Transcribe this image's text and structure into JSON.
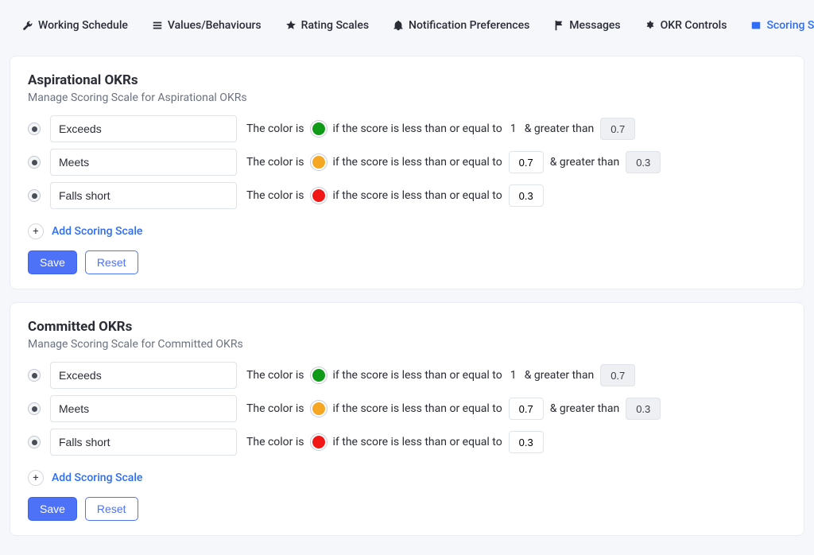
{
  "tabs": [
    {
      "label": "Working Schedule"
    },
    {
      "label": "Values/Behaviours"
    },
    {
      "label": "Rating Scales"
    },
    {
      "label": "Notification Preferences"
    },
    {
      "label": "Messages"
    },
    {
      "label": "OKR Controls"
    },
    {
      "label": "Scoring Scale",
      "active": true
    }
  ],
  "ui": {
    "add_scale": "Add Scoring Scale",
    "save": "Save",
    "reset": "Reset",
    "color_is": "The color is",
    "if_lte": "if the score is less than or equal to",
    "and_gt": "& greater than"
  },
  "colors": {
    "green": "#0f9a17",
    "amber": "#f5a623",
    "red": "#f11717"
  },
  "sections": [
    {
      "title": "Aspirational OKRs",
      "subtitle": "Manage Scoring Scale for Aspirational OKRs",
      "rows": [
        {
          "label": "Exceeds",
          "color": "green",
          "upper": "1",
          "lower": "0.7",
          "upper_static": true
        },
        {
          "label": "Meets",
          "color": "amber",
          "upper": "0.7",
          "lower": "0.3"
        },
        {
          "label": "Falls short",
          "color": "red",
          "upper": "0.3"
        }
      ]
    },
    {
      "title": "Committed OKRs",
      "subtitle": "Manage Scoring Scale for Committed OKRs",
      "rows": [
        {
          "label": "Exceeds",
          "color": "green",
          "upper": "1",
          "lower": "0.7",
          "upper_static": true
        },
        {
          "label": "Meets",
          "color": "amber",
          "upper": "0.7",
          "lower": "0.3"
        },
        {
          "label": "Falls short",
          "color": "red",
          "upper": "0.3"
        }
      ]
    }
  ]
}
